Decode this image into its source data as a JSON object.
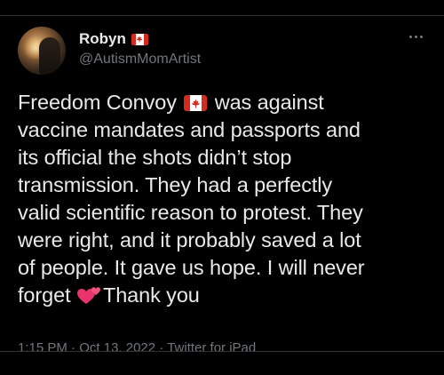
{
  "author": {
    "display_name": "Robyn",
    "handle": "@AutismMomArtist",
    "name_badge_icon": "canada-flag-icon"
  },
  "tweet": {
    "lines": {
      "l1_a": "Freedom Convoy",
      "l1_b": "was against",
      "l2": "vaccine mandates and passports and",
      "l3": "its official the shots didn’t stop",
      "l4": "transmission. They had a perfectly",
      "l5": "valid scientific reason to protest. They",
      "l6": "were right, and it probably saved a lot",
      "l7": "of people. It gave us hope. I will never",
      "l8_a": "forget",
      "l8_b": "Thank you"
    },
    "emoji": [
      "canada-flag-icon",
      "two-hearts-icon"
    ]
  },
  "meta": {
    "time": "1:15 PM",
    "separator": "·",
    "date": "Oct 13, 2022",
    "source": "Twitter for iPad"
  },
  "colors": {
    "background": "#000000",
    "text": "#e7e9ea",
    "muted": "#71767b",
    "flag_red": "#d52b1e",
    "heart_pink": "#e8336d"
  }
}
